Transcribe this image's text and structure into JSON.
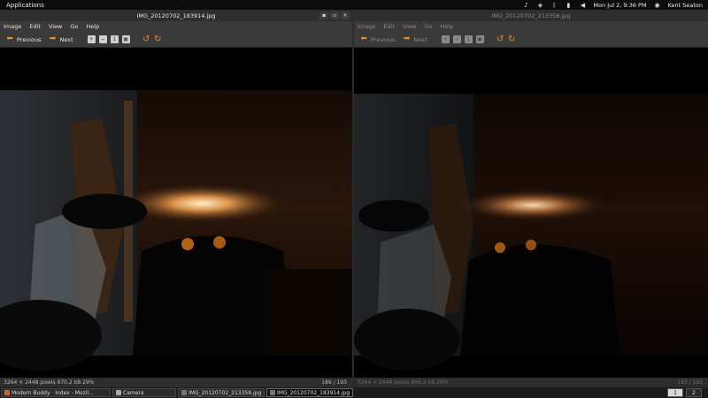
{
  "topbar": {
    "applications": "Applications",
    "clock": "Mon Jul 2, 9:36 PM",
    "user": "Kent Seaton"
  },
  "windows": [
    {
      "title": "IMG_20120702_183914.jpg",
      "menu": [
        "Image",
        "Edit",
        "View",
        "Go",
        "Help"
      ],
      "toolbar": {
        "previous": "Previous",
        "next": "Next"
      },
      "status": {
        "info": "3264 × 2448 pixels  970.2 kB    29%",
        "count": "189 / 193"
      }
    },
    {
      "title": "IMG_20120702_213358.jpg",
      "menu": [
        "Image",
        "Edit",
        "View",
        "Go",
        "Help"
      ],
      "toolbar": {
        "previous": "Previous",
        "next": "Next"
      },
      "status": {
        "info": "3264 × 2448 pixels  856.2 kB    29%",
        "count": "193 / 193"
      }
    }
  ],
  "window_controls": {
    "minimize": "▪",
    "maximize": "▫",
    "close": "×"
  },
  "taskbar": {
    "tasks": [
      {
        "label": "Modern Buddy · Index - Mozil..."
      },
      {
        "label": "Camera"
      },
      {
        "label": "IMG_20120702_213358.jpg"
      },
      {
        "label": "IMG_20120702_183914.jpg"
      }
    ],
    "workspaces": [
      "1",
      "2"
    ]
  },
  "colors": {
    "accent": "#f08a24",
    "panel": "#3a3a3a",
    "titlebar": "#2e2e2e"
  }
}
